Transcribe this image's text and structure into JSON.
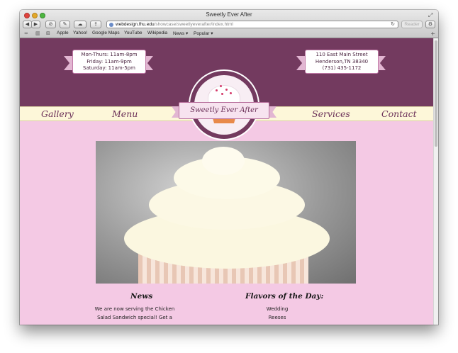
{
  "window": {
    "title": "Sweetly Ever After"
  },
  "toolbar": {
    "url_host": "webdesign.fhu.edu",
    "url_path": "/showcase/sweetlyeverafter/index.html",
    "reader_label": "Reader"
  },
  "bookmarks": {
    "items": [
      "Apple",
      "Yahoo!",
      "Google Maps",
      "YouTube",
      "Wikipedia",
      "News ▾",
      "Popular ▾"
    ]
  },
  "site": {
    "hours": [
      "Mon-Thurs: 11am-8pm",
      "Friday: 11am-9pm",
      "Saturday: 11am-5pm"
    ],
    "address": [
      "110 East Main Street",
      "Henderson,TN 38340",
      "(731) 435-1172"
    ],
    "logo_text": "Sweetly Ever After",
    "nav": {
      "gallery": "Gallery",
      "menu": "Menu",
      "services": "Services",
      "contact": "Contact"
    },
    "news": {
      "title": "News",
      "lines": [
        "We are now serving the Chicken",
        "Salad Sandwich special! Get a"
      ]
    },
    "flavors": {
      "title": "Flavors of the Day:",
      "items": [
        "Wedding",
        "Reeses"
      ]
    }
  },
  "colors": {
    "header": "#733a5f",
    "page_bg": "#f4c9e4",
    "nav_band": "#fdf7d9",
    "nav_text": "#6a2f57"
  },
  "icons": [
    "close-icon",
    "minimize-icon",
    "zoom-icon",
    "back-icon",
    "forward-icon",
    "history-icon",
    "settings-icon",
    "cloud-icon",
    "share-icon",
    "globe-icon",
    "reload-icon",
    "gear-icon",
    "reading-list-icon",
    "bookmarks-icon",
    "top-sites-icon",
    "fullscreen-icon"
  ]
}
